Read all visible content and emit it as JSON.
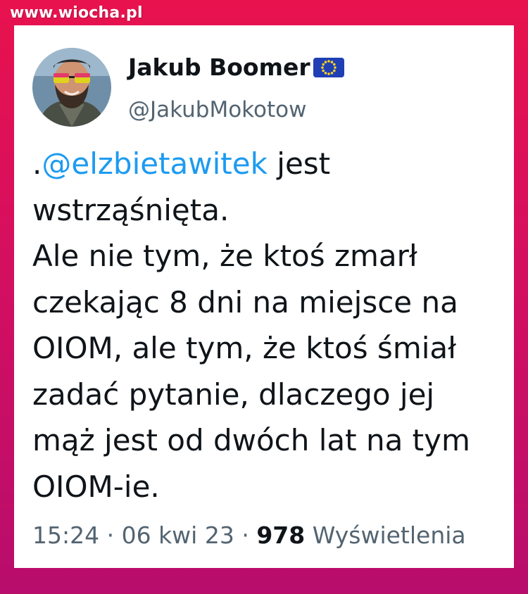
{
  "watermark": "www.wiocha.pl",
  "tweet": {
    "author": {
      "display_name": "Jakub Boomer",
      "badge_icon": "eu-flag-icon",
      "handle": "@JakubMokotow"
    },
    "body": {
      "prefix": ".",
      "mention": "@elzbietawitek",
      "line1_rest": " jest",
      "lines": [
        "wstrząśnięta.",
        "Ale nie tym, że ktoś zmarł",
        "czekając 8 dni na miejsce na",
        "OIOM, ale tym, że ktoś śmiał",
        "zadać pytanie, dlaczego jej",
        "mąż jest od dwóch lat na tym",
        "OIOM-ie."
      ]
    },
    "meta": {
      "time": "15:24",
      "separator": " · ",
      "date": "06 kwi 23",
      "views_count": "978",
      "views_label": "Wyświetlenia"
    }
  },
  "colors": {
    "background_top": "#e8124e",
    "background_bottom": "#b80d6c",
    "mention": "#1d9bf0",
    "text": "#0f1419",
    "secondary_text": "#536471"
  }
}
